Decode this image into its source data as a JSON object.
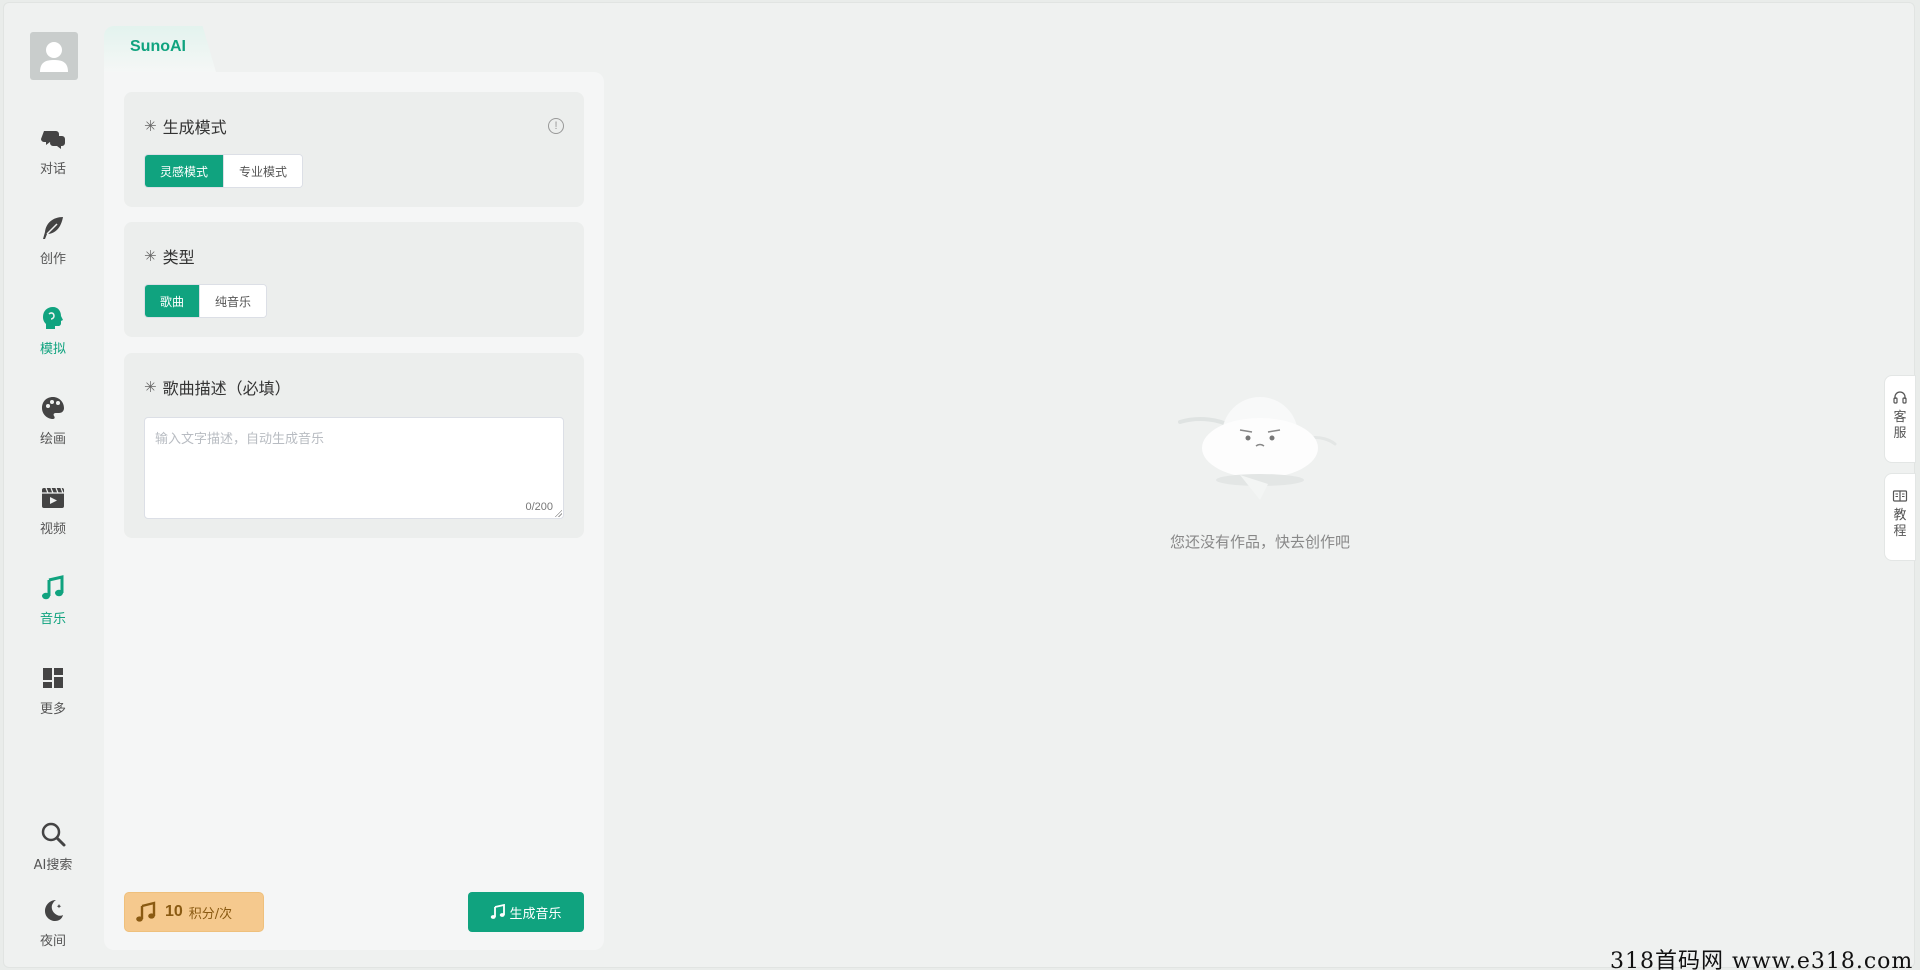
{
  "tab": {
    "label": "SunoAI"
  },
  "sidebar": {
    "items": [
      {
        "label": "对话"
      },
      {
        "label": "创作"
      },
      {
        "label": "模拟"
      },
      {
        "label": "绘画"
      },
      {
        "label": "视频"
      },
      {
        "label": "音乐"
      },
      {
        "label": "更多"
      }
    ],
    "bottom": [
      {
        "label": "AI搜索"
      },
      {
        "label": "夜间"
      }
    ],
    "active_color": "#10a37f"
  },
  "mode_section": {
    "star": "✳",
    "title": "生成模式",
    "info": "!",
    "options": [
      "灵感模式",
      "专业模式"
    ],
    "selected": "灵感模式"
  },
  "type_section": {
    "star": "✳",
    "title": "类型",
    "options": [
      "歌曲",
      "纯音乐"
    ],
    "selected": "歌曲"
  },
  "desc_section": {
    "star": "✳",
    "title": "歌曲描述（必填）",
    "placeholder": "输入文字描述，自动生成音乐",
    "value": "",
    "count": "0/200"
  },
  "footer": {
    "cost_value": "10",
    "cost_unit": "积分/次",
    "generate_label": "生成音乐"
  },
  "empty_state": {
    "text": "您还没有作品，快去创作吧"
  },
  "right_float": [
    {
      "label": "客服"
    },
    {
      "label": "教程"
    }
  ],
  "watermark": "318首码网  www.e318.com"
}
